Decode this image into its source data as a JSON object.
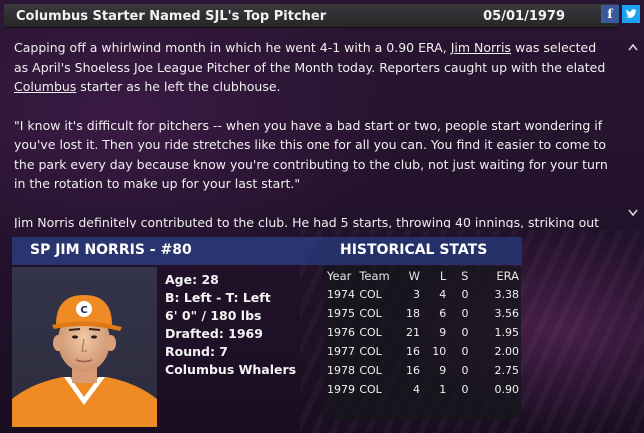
{
  "article": {
    "headline": "Columbus Starter Named SJL's Top Pitcher",
    "date": "05/01/1979",
    "share": {
      "facebook": "f",
      "twitter": "t"
    },
    "p1_before": "Capping off a whirlwind month in which he went 4-1 with a 0.90 ERA, ",
    "p1_link1": "Jim Norris",
    "p1_mid": " was selected as April's Shoeless Joe League Pitcher of the Month today. Reporters caught up with the elated ",
    "p1_link2": "Columbus",
    "p1_after": " starter as he left the clubhouse.",
    "p2": "\"I know it's difficult for pitchers -- when you have a bad start or two, people start wondering if you've lost it. Then you ride stretches like this one for all you can. You find it easier to come to the park every day because know you're contributing to the club, not just waiting for your turn in the rotation to make up for your last start.\"",
    "p3": "Jim Norris definitely contributed to the club. He had 5 starts, throwing 40 innings, striking out"
  },
  "scroll": {
    "up": "^",
    "down": "v"
  },
  "player": {
    "header": "SP JIM NORRIS - #80",
    "age": "Age: 28",
    "bats_throws": "B: Left - T: Left",
    "height_weight": "6' 0\" / 180 lbs",
    "drafted": "Drafted: 1969",
    "round": "Round: 7",
    "team": "Columbus Whalers"
  },
  "stats": {
    "header": "HISTORICAL STATS",
    "columns": [
      "Year",
      "Team",
      "W",
      "L",
      "S",
      "ERA"
    ],
    "rows": [
      [
        "1974",
        "COL",
        "3",
        "4",
        "0",
        "3.38"
      ],
      [
        "1975",
        "COL",
        "18",
        "6",
        "0",
        "3.56"
      ],
      [
        "1976",
        "COL",
        "21",
        "9",
        "0",
        "1.95"
      ],
      [
        "1977",
        "COL",
        "16",
        "10",
        "0",
        "2.00"
      ],
      [
        "1978",
        "COL",
        "16",
        "9",
        "0",
        "2.75"
      ],
      [
        "1979",
        "COL",
        "4",
        "1",
        "0",
        "0.90"
      ]
    ]
  },
  "colors": {
    "background": "#24122c",
    "panel_header": "#2a3570",
    "facebook": "#3b5998",
    "twitter": "#1da1f2",
    "jersey": "#f08a24"
  }
}
